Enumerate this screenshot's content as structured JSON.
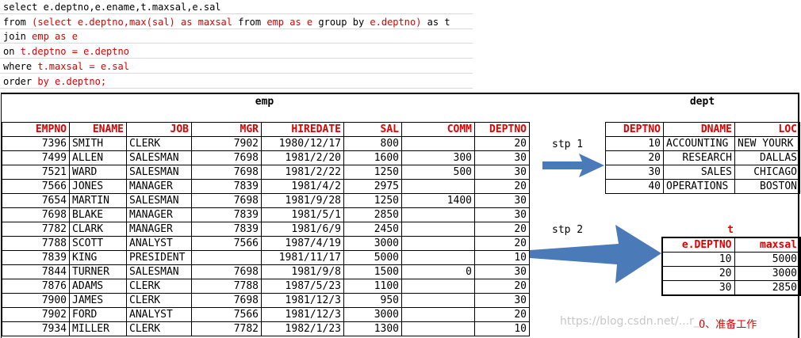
{
  "sql": {
    "lines": [
      [
        {
          "t": "select e.deptno,e.ename,t.maxsal,e.sal",
          "c": "k"
        }
      ],
      [
        {
          "t": "from ",
          "c": "k"
        },
        {
          "t": "(select e.deptno,max(sal) as maxsal",
          "c": "r"
        },
        {
          "t": " from ",
          "c": "k"
        },
        {
          "t": "emp as e",
          "c": "r"
        },
        {
          "t": " group by ",
          "c": "k"
        },
        {
          "t": "e.deptno)",
          "c": "r"
        },
        {
          "t": " as t",
          "c": "k"
        }
      ],
      [
        {
          "t": "join ",
          "c": "k"
        },
        {
          "t": "emp as e",
          "c": "r"
        }
      ],
      [
        {
          "t": "on ",
          "c": "k"
        },
        {
          "t": "t.deptno = e.deptno",
          "c": "r"
        }
      ],
      [
        {
          "t": "where ",
          "c": "k"
        },
        {
          "t": "t.maxsal = e.sal",
          "c": "r"
        }
      ],
      [
        {
          "t": "order ",
          "c": "k"
        },
        {
          "t": "by e.deptno;",
          "c": "r"
        }
      ]
    ]
  },
  "emp": {
    "caption": "emp",
    "headers": [
      "EMPNO",
      "ENAME",
      "JOB",
      "MGR",
      "HIREDATE",
      "SAL",
      "COMM",
      "DEPTNO"
    ],
    "rows": [
      [
        "7396",
        "SMITH",
        "CLERK",
        "7902",
        "1980/12/17",
        "800",
        "",
        "20"
      ],
      [
        "7499",
        "ALLEN",
        "SALESMAN",
        "7698",
        "1981/2/20",
        "1600",
        "300",
        "30"
      ],
      [
        "7521",
        "WARD",
        "SALESMAN",
        "7698",
        "1981/2/22",
        "1250",
        "500",
        "30"
      ],
      [
        "7566",
        "JONES",
        "MANAGER",
        "7839",
        "1981/4/2",
        "2975",
        "",
        "20"
      ],
      [
        "7654",
        "MARTIN",
        "SALESMAN",
        "7698",
        "1981/9/28",
        "1250",
        "1400",
        "30"
      ],
      [
        "7698",
        "BLAKE",
        "MANAGER",
        "7839",
        "1981/5/1",
        "2850",
        "",
        "30"
      ],
      [
        "7782",
        "CLARK",
        "MANAGER",
        "7839",
        "1981/6/9",
        "2450",
        "",
        "20"
      ],
      [
        "7788",
        "SCOTT",
        "ANALYST",
        "7566",
        "1987/4/19",
        "3000",
        "",
        "20"
      ],
      [
        "7839",
        "KING",
        "PRESIDENT",
        "",
        "1981/11/17",
        "5000",
        "",
        "10"
      ],
      [
        "7844",
        "TURNER",
        "SALESMAN",
        "7698",
        "1981/9/8",
        "1500",
        "0",
        "30"
      ],
      [
        "7876",
        "ADAMS",
        "CLERK",
        "7788",
        "1987/5/23",
        "1100",
        "",
        "20"
      ],
      [
        "7900",
        "JAMES",
        "CLERK",
        "7698",
        "1981/12/3",
        "950",
        "",
        "30"
      ],
      [
        "7902",
        "FORD",
        "ANALYST",
        "7566",
        "1981/12/3",
        "3000",
        "",
        "20"
      ],
      [
        "7934",
        "MILLER",
        "CLERK",
        "7782",
        "1982/1/23",
        "1300",
        "",
        "10"
      ]
    ]
  },
  "dept": {
    "caption": "dept",
    "headers": [
      "DEPTNO",
      "DNAME",
      "LOC"
    ],
    "rows": [
      [
        "10",
        "ACCOUNTING",
        "NEW YOURK"
      ],
      [
        "20",
        "RESEARCH",
        "DALLAS"
      ],
      [
        "30",
        "SALES",
        "CHICAGO"
      ],
      [
        "40",
        "OPERATIONS",
        "BOSTON"
      ]
    ]
  },
  "t": {
    "caption": "t",
    "headers": [
      "e.DEPTNO",
      "maxsal"
    ],
    "rows": [
      [
        "10",
        "5000"
      ],
      [
        "20",
        "3000"
      ],
      [
        "30",
        "2850"
      ]
    ]
  },
  "steps": {
    "step1": "stp 1",
    "step2": "stp 2"
  },
  "note": "0、准备工作",
  "watermark": "https://blog.csdn.net/...r_c",
  "colors": {
    "accent_red": "#e00000",
    "arrow_blue": "#4a7ab8"
  }
}
